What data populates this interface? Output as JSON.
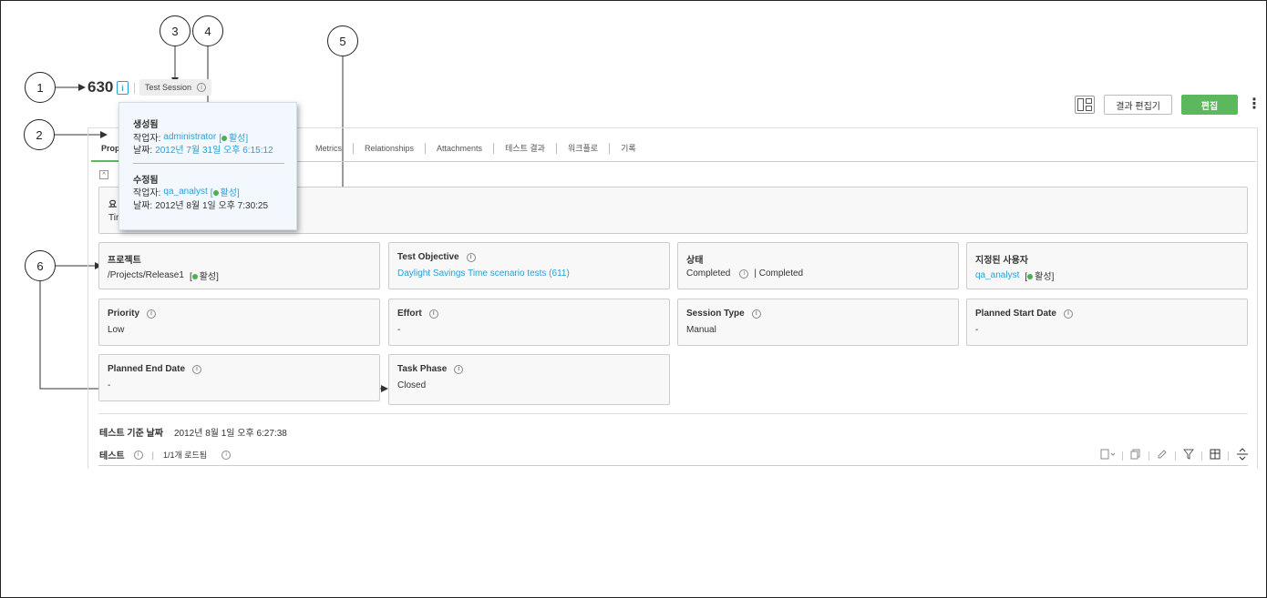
{
  "callouts": [
    "1",
    "2",
    "3",
    "4",
    "5",
    "6"
  ],
  "header": {
    "item_id": "630",
    "doc_icon_glyph": "i",
    "type_badge": "Test Session",
    "layout_icon": "layout-icon",
    "results_editor_label": "결과 편집기",
    "edit_label": "편집",
    "more_glyph": "⋮"
  },
  "tabs": [
    "Properties",
    "Metrics",
    "Relationships",
    "Attachments",
    "테스트 결과",
    "워크플로",
    "기록"
  ],
  "tabs_visible": [
    "Prop",
    "Metrics",
    "Relationships",
    "Attachments",
    "테스트 결과",
    "워크플로",
    "기록"
  ],
  "section": {
    "collapse_glyph": "^",
    "summary_label": "요",
    "summary_value": "Tir"
  },
  "fields": {
    "project": {
      "label": "프로젝트",
      "value": "/Projects/Release1",
      "status": "활성"
    },
    "test_objective": {
      "label": "Test Objective",
      "value": "Daylight Savings Time scenario tests (611)"
    },
    "state": {
      "label": "상태",
      "value": "Completed",
      "value2": "| Completed"
    },
    "assigned_user": {
      "label": "지정된 사용자",
      "value": "qa_analyst",
      "status": "활성"
    },
    "priority": {
      "label": "Priority",
      "value": "Low"
    },
    "effort": {
      "label": "Effort",
      "value": "-"
    },
    "session_type": {
      "label": "Session Type",
      "value": "Manual"
    },
    "planned_start": {
      "label": "Planned Start Date",
      "value": "-"
    },
    "planned_end": {
      "label": "Planned End Date",
      "value": "-"
    },
    "task_phase": {
      "label": "Task Phase",
      "value": "Closed"
    }
  },
  "footer": {
    "base_date_label": "테스트 기준 날짜",
    "base_date_value": "2012년 8월 1일 오후 6:27:38",
    "tests_label": "테스트",
    "loaded_text": "1/1개 로드됨"
  },
  "popup": {
    "created_title": "생성됨",
    "created_by_label": "작업자:",
    "created_by": "administrator",
    "created_status": "활성",
    "created_date_label": "날짜:",
    "created_date": "2012년 7월 31일 오후 6:15:12",
    "modified_title": "수정됨",
    "modified_by_label": "작업자:",
    "modified_by": "qa_analyst",
    "modified_status": "활성",
    "modified_date_label": "날짜:",
    "modified_date": "2012년 8월 1일 오후 7:30:25"
  },
  "colors": {
    "accent_green": "#5cb85c",
    "link_blue": "#2a9fd6",
    "status_dot": "#4caf50"
  }
}
